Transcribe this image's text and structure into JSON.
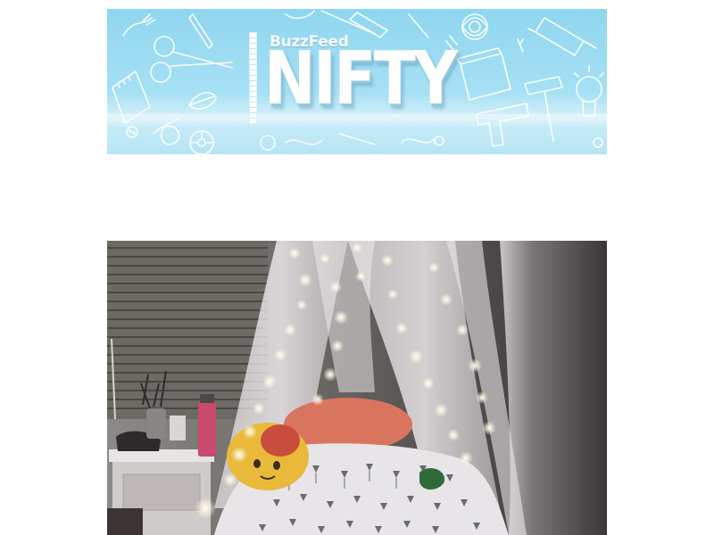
{
  "banner": {
    "brand_small": "BuzzFeed",
    "brand_big": "NIFTY",
    "background_color": "#9ddcf2",
    "icons": [
      "scissors-icon",
      "paintbrush-icon",
      "hammer-icon",
      "lightbulb-icon",
      "glue-gun-icon",
      "glue-bottle-icon",
      "mason-jar-icon",
      "notepad-icon",
      "pencil-icon",
      "leaf-icon",
      "button-icon",
      "flower-icon",
      "ruler-icon",
      "pushpin-icon"
    ]
  },
  "photo": {
    "subject": "bed-canopy-with-fairy-lights",
    "colors": {
      "wall": "#3c3838",
      "curtain": "#e8e4e6",
      "pillow": "#d9755f",
      "plush": "#e9b93a",
      "bottle": "#c94a6c",
      "bedding": "#e7e5e8"
    }
  }
}
